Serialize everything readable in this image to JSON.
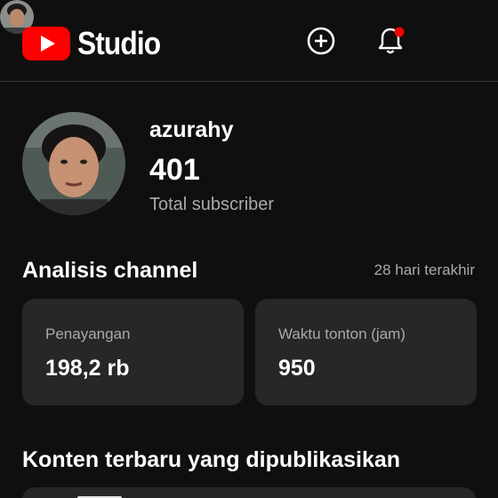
{
  "header": {
    "logo_text": "Studio",
    "create_icon": "plus-circle-icon",
    "bell_icon": "bell-icon",
    "notification_dot_color": "#ff0000"
  },
  "channel": {
    "name": "azurahy",
    "subscriber_count": "401",
    "subscriber_label": "Total subscriber"
  },
  "analytics": {
    "title": "Analisis channel",
    "period": "28 hari terakhir",
    "cards": [
      {
        "label": "Penayangan",
        "value": "198,2 rb"
      },
      {
        "label": "Waktu tonton (jam)",
        "value": "950"
      }
    ]
  },
  "recent": {
    "title": "Konten terbaru yang dipublikasikan"
  },
  "colors": {
    "background": "#0f0f0f",
    "card": "#272727",
    "brand": "#ff0000",
    "secondary_text": "#aaaaaa"
  }
}
